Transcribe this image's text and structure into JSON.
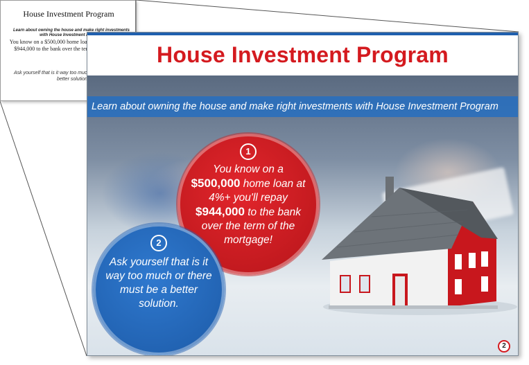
{
  "notes": {
    "title": "House Investment Program",
    "subtitle": "Learn about owning the house and make right investments with  House Investment Program",
    "paragraph1": "You know on a $500,000 home loan at 4%+ you'll repay $944,000 to the bank over the term of the mortgage!",
    "paragraph2": "Ask yourself that is it way too much or there must be a better solution"
  },
  "slide": {
    "title": "House Investment Program",
    "banner": "Learn about owning the house and make right investments with  House Investment Program",
    "point1": {
      "number": "1",
      "line_a": "You know on a",
      "amount1": "$500,000",
      "line_b": " home loan at 4%+ you'll repay ",
      "amount2": "$944,000",
      "line_c": " to the bank over the term of the mortgage!"
    },
    "point2": {
      "number": "2",
      "text": "Ask yourself that is it way too much or there must be a better solution."
    },
    "page_number": "2"
  },
  "colors": {
    "title_red": "#d41a1f",
    "banner_blue": "#286ebe",
    "circle_red": "#c81c21",
    "circle_blue": "#2366b9"
  }
}
